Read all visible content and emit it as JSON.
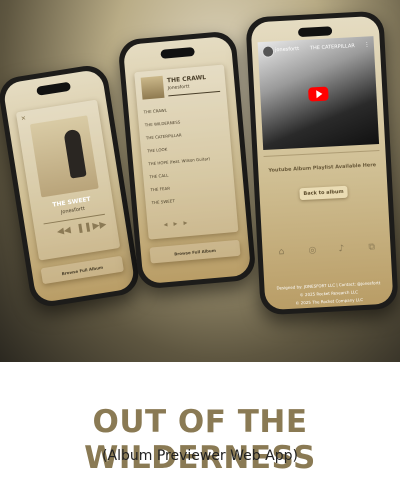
{
  "phone_left": {
    "album_title": "THE SWEET",
    "artist": "Jonesfortt",
    "footer": "Browse Full Album"
  },
  "phone_middle": {
    "album_title": "THE CRAWL",
    "artist": "Jonesfortt",
    "tracks": [
      "THE CRAWL",
      "THE WILDERNESS",
      "THE CATERPILLAR",
      "THE LOOK",
      "THE HOPE (feat. Wilson Guitar)",
      "THE CALL",
      "THE FEAR",
      "THE SWEET"
    ],
    "footer": "Browse Full Album"
  },
  "phone_right": {
    "video_channel": "jonesfortt",
    "video_title": "THE CATERPILLAR",
    "caption": "Youtube Album Playlist Available Here",
    "back_button": "Back to album",
    "footer_lines": [
      "Designed by: JONESFORT LLC | Contact: @jonesfortt",
      "© 2025 Rocket Research LLC",
      "© 2025 The Rocket Company LLC"
    ]
  },
  "title": "OUT OF THE WILDERNESS",
  "subtitle": "(Album Previewer Web App)",
  "colors": {
    "accent": "#8a7a54",
    "youtube_red": "#ff0000"
  }
}
